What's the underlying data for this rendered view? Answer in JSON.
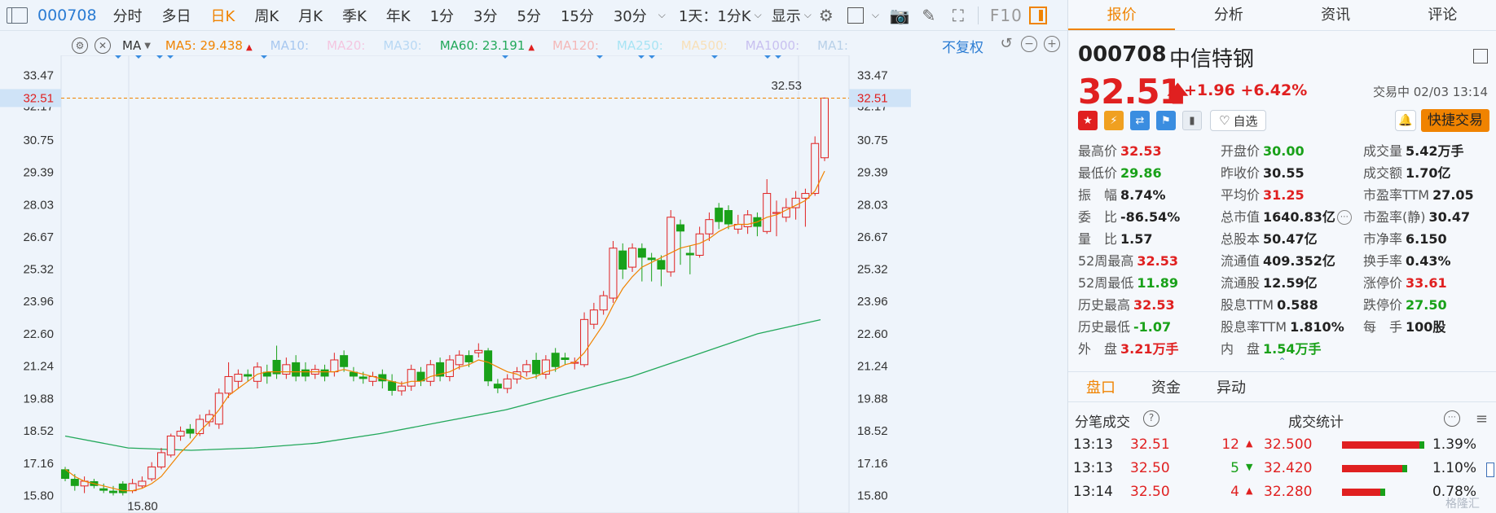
{
  "toolbar": {
    "code": "000708",
    "periods": [
      "分时",
      "多日",
      "日K",
      "周K",
      "月K",
      "季K",
      "年K",
      "1分",
      "3分",
      "5分",
      "15分",
      "30分"
    ],
    "active_period": "日K",
    "period_select": "1天：1分K",
    "display": "显示",
    "f10": "F10"
  },
  "ma_bar": {
    "selector": "MA",
    "items": [
      {
        "label": "MA5: 29.438",
        "color": "#f08300",
        "trend": "up"
      },
      {
        "label": "MA10:",
        "color": "#a8c8f0",
        "trend": ""
      },
      {
        "label": "MA20:",
        "color": "#f4c6e0",
        "trend": ""
      },
      {
        "label": "MA30:",
        "color": "#b8d8f4",
        "trend": ""
      },
      {
        "label": "MA60: 23.191",
        "color": "#22a85a",
        "trend": "up"
      },
      {
        "label": "MA120:",
        "color": "#f4b8b8",
        "trend": ""
      },
      {
        "label": "MA250:",
        "color": "#a8e4f4",
        "trend": ""
      },
      {
        "label": "MA500:",
        "color": "#f8e0b8",
        "trend": ""
      },
      {
        "label": "MA1000:",
        "color": "#c8c0f0",
        "trend": ""
      },
      {
        "label": "MA1:",
        "color": "#b8d0e8",
        "trend": ""
      }
    ],
    "adjust": "不复权"
  },
  "chart_data": {
    "type": "candlestick",
    "y_ticks": [
      "33.47",
      "32.17",
      "30.75",
      "29.39",
      "28.03",
      "26.67",
      "25.32",
      "23.96",
      "22.60",
      "21.24",
      "19.88",
      "18.52",
      "17.16",
      "15.80"
    ],
    "current_price_label": "32.51",
    "max_label": "32.53",
    "min_label": "15.80",
    "ylim": [
      15.2,
      34.1
    ],
    "candles": [
      {
        "o": 16.9,
        "c": 16.5,
        "h": 17.0,
        "l": 16.4
      },
      {
        "o": 16.5,
        "c": 16.2,
        "h": 16.7,
        "l": 16.0
      },
      {
        "o": 16.2,
        "c": 16.4,
        "h": 16.6,
        "l": 15.9
      },
      {
        "o": 16.4,
        "c": 16.2,
        "h": 16.5,
        "l": 16.1
      },
      {
        "o": 16.1,
        "c": 16.0,
        "h": 16.3,
        "l": 15.9
      },
      {
        "o": 16.0,
        "c": 15.9,
        "h": 16.2,
        "l": 15.8
      },
      {
        "o": 16.3,
        "c": 15.9,
        "h": 16.4,
        "l": 15.8
      },
      {
        "o": 16.0,
        "c": 16.3,
        "h": 16.5,
        "l": 15.9
      },
      {
        "o": 16.2,
        "c": 16.4,
        "h": 16.6,
        "l": 16.1
      },
      {
        "o": 16.5,
        "c": 17.0,
        "h": 17.2,
        "l": 16.4
      },
      {
        "o": 17.0,
        "c": 17.6,
        "h": 17.8,
        "l": 16.9
      },
      {
        "o": 17.5,
        "c": 18.3,
        "h": 18.4,
        "l": 17.4
      },
      {
        "o": 18.3,
        "c": 18.5,
        "h": 18.7,
        "l": 18.1
      },
      {
        "o": 18.6,
        "c": 18.4,
        "h": 18.8,
        "l": 18.2
      },
      {
        "o": 18.4,
        "c": 19.0,
        "h": 19.2,
        "l": 18.3
      },
      {
        "o": 18.9,
        "c": 19.2,
        "h": 19.4,
        "l": 18.7
      },
      {
        "o": 18.8,
        "c": 20.1,
        "h": 20.3,
        "l": 18.6
      },
      {
        "o": 20.1,
        "c": 20.8,
        "h": 21.4,
        "l": 19.9
      },
      {
        "o": 20.6,
        "c": 20.9,
        "h": 21.1,
        "l": 20.3
      },
      {
        "o": 20.9,
        "c": 20.8,
        "h": 21.1,
        "l": 20.6
      },
      {
        "o": 20.6,
        "c": 21.2,
        "h": 21.4,
        "l": 20.3
      },
      {
        "o": 21.0,
        "c": 20.8,
        "h": 21.3,
        "l": 20.5
      },
      {
        "o": 21.5,
        "c": 20.9,
        "h": 22.1,
        "l": 20.7
      },
      {
        "o": 20.9,
        "c": 21.3,
        "h": 21.6,
        "l": 20.7
      },
      {
        "o": 21.4,
        "c": 20.8,
        "h": 21.7,
        "l": 20.6
      },
      {
        "o": 21.1,
        "c": 20.8,
        "h": 21.4,
        "l": 20.6
      },
      {
        "o": 20.9,
        "c": 21.1,
        "h": 21.3,
        "l": 20.7
      },
      {
        "o": 21.1,
        "c": 20.8,
        "h": 21.3,
        "l": 20.6
      },
      {
        "o": 21.0,
        "c": 21.5,
        "h": 21.8,
        "l": 20.8
      },
      {
        "o": 21.7,
        "c": 21.2,
        "h": 21.9,
        "l": 21.0
      },
      {
        "o": 21.0,
        "c": 20.8,
        "h": 21.2,
        "l": 20.6
      },
      {
        "o": 20.8,
        "c": 20.7,
        "h": 21.0,
        "l": 20.5
      },
      {
        "o": 20.6,
        "c": 20.8,
        "h": 21.0,
        "l": 20.4
      },
      {
        "o": 20.9,
        "c": 20.6,
        "h": 21.1,
        "l": 20.3
      },
      {
        "o": 20.6,
        "c": 20.2,
        "h": 20.9,
        "l": 20.0
      },
      {
        "o": 20.2,
        "c": 20.4,
        "h": 20.6,
        "l": 20.0
      },
      {
        "o": 20.4,
        "c": 21.1,
        "h": 21.3,
        "l": 20.2
      },
      {
        "o": 21.0,
        "c": 20.6,
        "h": 21.2,
        "l": 20.4
      },
      {
        "o": 20.6,
        "c": 21.3,
        "h": 21.5,
        "l": 20.4
      },
      {
        "o": 21.4,
        "c": 20.8,
        "h": 21.6,
        "l": 20.6
      },
      {
        "o": 20.8,
        "c": 21.5,
        "h": 21.7,
        "l": 20.6
      },
      {
        "o": 21.3,
        "c": 21.7,
        "h": 21.9,
        "l": 21.1
      },
      {
        "o": 21.7,
        "c": 21.4,
        "h": 21.9,
        "l": 21.2
      },
      {
        "o": 21.8,
        "c": 21.9,
        "h": 22.2,
        "l": 21.6
      },
      {
        "o": 21.9,
        "c": 20.6,
        "h": 22.0,
        "l": 20.4
      },
      {
        "o": 20.5,
        "c": 20.3,
        "h": 20.7,
        "l": 20.1
      },
      {
        "o": 20.3,
        "c": 20.7,
        "h": 20.9,
        "l": 20.1
      },
      {
        "o": 20.7,
        "c": 21.0,
        "h": 21.2,
        "l": 20.5
      },
      {
        "o": 21.0,
        "c": 21.3,
        "h": 21.5,
        "l": 20.8
      },
      {
        "o": 21.5,
        "c": 20.9,
        "h": 21.8,
        "l": 20.7
      },
      {
        "o": 20.9,
        "c": 21.5,
        "h": 21.7,
        "l": 20.7
      },
      {
        "o": 21.8,
        "c": 21.2,
        "h": 22.0,
        "l": 21.0
      },
      {
        "o": 21.6,
        "c": 21.5,
        "h": 21.8,
        "l": 21.3
      },
      {
        "o": 21.4,
        "c": 21.4,
        "h": 21.6,
        "l": 21.1
      },
      {
        "o": 21.3,
        "c": 23.2,
        "h": 23.5,
        "l": 21.2
      },
      {
        "o": 23.0,
        "c": 23.6,
        "h": 23.9,
        "l": 22.8
      },
      {
        "o": 23.6,
        "c": 24.2,
        "h": 24.4,
        "l": 23.4
      },
      {
        "o": 24.1,
        "c": 26.2,
        "h": 26.5,
        "l": 23.9
      },
      {
        "o": 26.1,
        "c": 25.3,
        "h": 26.4,
        "l": 24.9
      },
      {
        "o": 25.4,
        "c": 26.2,
        "h": 26.4,
        "l": 25.2
      },
      {
        "o": 26.2,
        "c": 25.8,
        "h": 26.4,
        "l": 24.8
      },
      {
        "o": 25.8,
        "c": 25.7,
        "h": 26.0,
        "l": 24.8
      },
      {
        "o": 25.7,
        "c": 25.3,
        "h": 25.9,
        "l": 24.6
      },
      {
        "o": 25.2,
        "c": 27.5,
        "h": 27.8,
        "l": 25.0
      },
      {
        "o": 27.2,
        "c": 26.9,
        "h": 27.4,
        "l": 25.5
      },
      {
        "o": 26.0,
        "c": 25.9,
        "h": 26.3,
        "l": 25.1
      },
      {
        "o": 25.9,
        "c": 26.8,
        "h": 27.1,
        "l": 25.8
      },
      {
        "o": 26.8,
        "c": 27.4,
        "h": 27.7,
        "l": 26.5
      },
      {
        "o": 27.9,
        "c": 27.3,
        "h": 28.1,
        "l": 27.0
      },
      {
        "o": 27.8,
        "c": 27.2,
        "h": 28.0,
        "l": 27.0
      },
      {
        "o": 27.0,
        "c": 27.2,
        "h": 27.6,
        "l": 26.8
      },
      {
        "o": 27.1,
        "c": 27.6,
        "h": 27.8,
        "l": 26.8
      },
      {
        "o": 27.5,
        "c": 27.1,
        "h": 27.7,
        "l": 26.7
      },
      {
        "o": 26.9,
        "c": 28.5,
        "h": 29.1,
        "l": 26.8
      },
      {
        "o": 27.7,
        "c": 27.7,
        "h": 28.2,
        "l": 26.7
      },
      {
        "o": 27.5,
        "c": 27.9,
        "h": 28.3,
        "l": 27.3
      },
      {
        "o": 27.9,
        "c": 28.3,
        "h": 28.6,
        "l": 27.4
      },
      {
        "o": 28.3,
        "c": 28.5,
        "h": 28.7,
        "l": 27.1
      },
      {
        "o": 28.5,
        "c": 30.6,
        "h": 30.9,
        "l": 28.4
      },
      {
        "o": 30.0,
        "c": 32.51,
        "h": 32.53,
        "l": 29.86
      }
    ],
    "ma5": [
      16.9,
      16.6,
      16.4,
      16.3,
      16.2,
      16.1,
      16.0,
      16.0,
      16.1,
      16.3,
      16.6,
      17.1,
      17.6,
      18.0,
      18.5,
      18.9,
      19.4,
      20.0,
      20.3,
      20.6,
      20.9,
      21.0,
      21.0,
      21.0,
      21.0,
      21.0,
      21.0,
      21.0,
      21.0,
      21.1,
      21.0,
      20.9,
      20.8,
      20.7,
      20.6,
      20.5,
      20.6,
      20.6,
      20.8,
      20.9,
      21.0,
      21.2,
      21.3,
      21.5,
      21.4,
      21.2,
      21.0,
      20.9,
      20.7,
      20.8,
      21.0,
      21.1,
      21.3,
      21.4,
      21.8,
      22.4,
      23.0,
      23.8,
      24.5,
      25.0,
      25.4,
      25.6,
      25.8,
      26.0,
      26.2,
      26.3,
      26.4,
      26.6,
      26.9,
      27.1,
      27.2,
      27.2,
      27.3,
      27.5,
      27.6,
      27.8,
      28.0,
      28.2,
      28.6,
      29.44
    ],
    "ma60_label": "MA60",
    "ma60": [
      18.3,
      17.8,
      17.7,
      17.8,
      18.0,
      18.4,
      18.9,
      19.4,
      20.1,
      20.8,
      21.7,
      22.6,
      23.19
    ]
  },
  "side": {
    "tabs": [
      "报价",
      "分析",
      "资讯",
      "评论"
    ],
    "active_tab": "报价",
    "code": "000708",
    "name": "中信特钢",
    "price": "32.51",
    "change": "+1.96",
    "change_pct": "+6.42%",
    "status": "交易中 02/03 13:14",
    "watchlist": "自选",
    "quick_trade": "快捷交易",
    "stats": [
      [
        {
          "label": "最高价",
          "value": "32.53",
          "c": "red"
        },
        {
          "label": "开盘价",
          "value": "30.00",
          "c": "green"
        },
        {
          "label": "成交量",
          "value": "5.42万手",
          "c": "black"
        }
      ],
      [
        {
          "label": "最低价",
          "value": "29.86",
          "c": "green"
        },
        {
          "label": "昨收价",
          "value": "30.55",
          "c": "black"
        },
        {
          "label": "成交额",
          "value": "1.70亿",
          "c": "black"
        }
      ],
      [
        {
          "label": "振　幅",
          "value": "8.74%",
          "c": "black"
        },
        {
          "label": "平均价",
          "value": "31.25",
          "c": "red"
        },
        {
          "label": "市盈率TTM",
          "value": "27.05",
          "c": "black"
        }
      ],
      [
        {
          "label": "委　比",
          "value": "-86.54%",
          "c": "black"
        },
        {
          "label": "总市值",
          "value": "1640.83亿",
          "c": "black"
        },
        {
          "label": "市盈率(静)",
          "value": "30.47",
          "c": "black"
        }
      ],
      [
        {
          "label": "量　比",
          "value": "1.57",
          "c": "black"
        },
        {
          "label": "总股本",
          "value": "50.47亿",
          "c": "black"
        },
        {
          "label": "市净率",
          "value": "6.150",
          "c": "black"
        }
      ],
      [
        {
          "label": "52周最高",
          "value": "32.53",
          "c": "red"
        },
        {
          "label": "流通值",
          "value": "409.352亿",
          "c": "black"
        },
        {
          "label": "换手率",
          "value": "0.43%",
          "c": "black"
        }
      ],
      [
        {
          "label": "52周最低",
          "value": "11.89",
          "c": "green"
        },
        {
          "label": "流通股",
          "value": "12.59亿",
          "c": "black"
        },
        {
          "label": "涨停价",
          "value": "33.61",
          "c": "red"
        }
      ],
      [
        {
          "label": "历史最高",
          "value": "32.53",
          "c": "red"
        },
        {
          "label": "股息TTM",
          "value": "0.588",
          "c": "black"
        },
        {
          "label": "跌停价",
          "value": "27.50",
          "c": "green"
        }
      ],
      [
        {
          "label": "历史最低",
          "value": "-1.07",
          "c": "green"
        },
        {
          "label": "股息率TTM",
          "value": "1.810%",
          "c": "black"
        },
        {
          "label": "每　手",
          "value": "100股",
          "c": "black"
        }
      ],
      [
        {
          "label": "外　盘",
          "value": "3.21万手",
          "c": "red"
        },
        {
          "label": "内　盘",
          "value": "1.54万手",
          "c": "green"
        }
      ]
    ],
    "subtabs": [
      "盘口",
      "资金",
      "异动"
    ],
    "active_subtab": "盘口",
    "trades_title": "分笔成交",
    "stats_title": "成交统计",
    "trades": [
      {
        "time": "13:13",
        "price": "32.51",
        "vol": "12",
        "dir": "up",
        "stat_price": "32.500",
        "pct": "1.39%",
        "bar": 0.95
      },
      {
        "time": "13:13",
        "price": "32.50",
        "vol": "5",
        "dir": "down",
        "stat_price": "32.420",
        "pct": "1.10%",
        "bar": 0.75
      },
      {
        "time": "13:14",
        "price": "32.50",
        "vol": "4",
        "dir": "up",
        "stat_price": "32.280",
        "pct": "0.78%",
        "bar": 0.5
      }
    ],
    "watermark": "格隆汇"
  }
}
